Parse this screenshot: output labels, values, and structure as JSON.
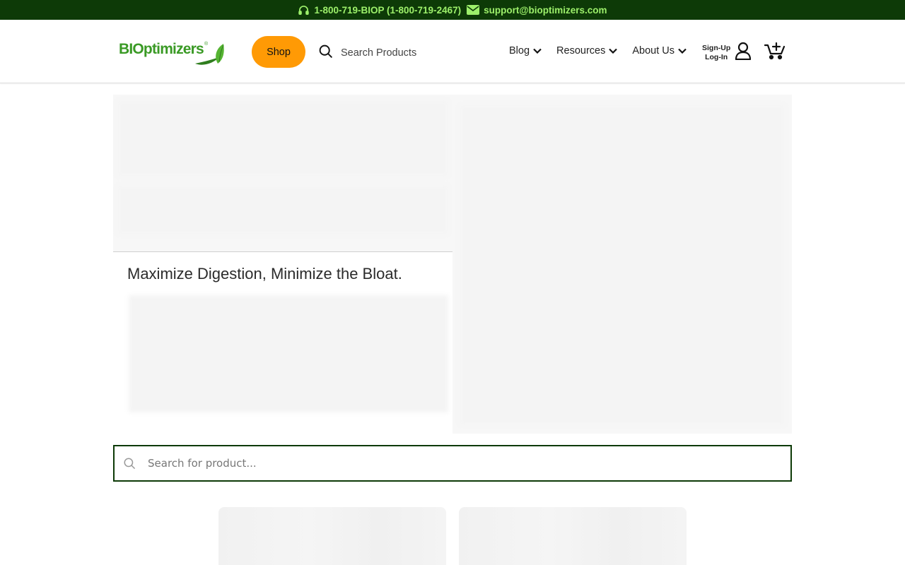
{
  "topbar": {
    "phone": "1-800-719-BIOP (1-800-719-2467)",
    "email": "support@bioptimizers.com",
    "bg_color": "#0d3a07",
    "text_color": "#9df06b"
  },
  "header": {
    "logo_text": "BIOptimizers",
    "logo_mark": "®",
    "shop_label": "Shop",
    "shop_color": "#ff9a05",
    "search_label": "Search Products",
    "nav": [
      {
        "label": "Blog"
      },
      {
        "label": "Resources"
      },
      {
        "label": "About Us"
      }
    ],
    "account": {
      "signup": "Sign-Up",
      "login": "Log-In"
    }
  },
  "main": {
    "headline": "Maximize Digestion, Minimize the Bloat."
  },
  "product_search": {
    "placeholder": "Search for product...",
    "value": ""
  },
  "icons": {
    "phone": "headset-icon",
    "email": "envelope-icon",
    "search": "search-icon",
    "dropdown": "chevron-down-icon",
    "account": "user-icon",
    "cart": "cart-add-icon"
  }
}
